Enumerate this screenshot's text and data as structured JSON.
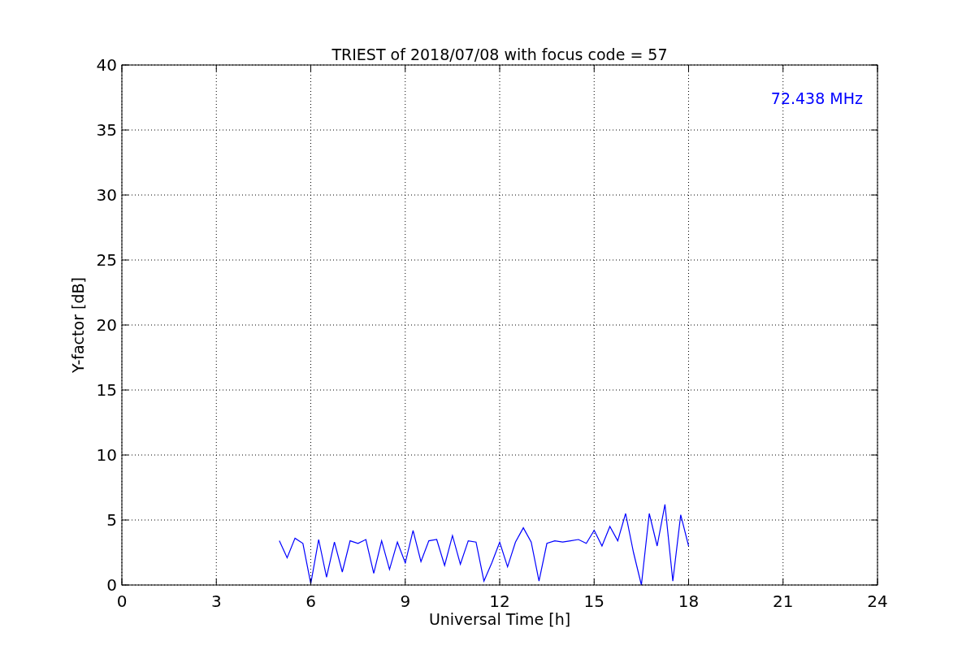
{
  "chart_data": {
    "type": "line",
    "title": "TRIEST of 2018/07/08 with focus code = 57",
    "xlabel": "Universal Time [h]",
    "ylabel": "Y-factor [dB]",
    "grid": true,
    "xlim": [
      0,
      24
    ],
    "ylim": [
      0,
      40
    ],
    "xticks": [
      0,
      3,
      6,
      9,
      12,
      15,
      18,
      21,
      24
    ],
    "yticks": [
      0,
      5,
      10,
      15,
      20,
      25,
      30,
      35,
      40
    ],
    "x": [
      5,
      5.25,
      5.5,
      5.75,
      6,
      6.25,
      6.5,
      6.75,
      7,
      7.25,
      7.5,
      7.75,
      8,
      8.25,
      8.5,
      8.75,
      9,
      9.25,
      9.5,
      9.75,
      10,
      10.25,
      10.5,
      10.75,
      11,
      11.25,
      11.5,
      11.75,
      12,
      12.25,
      12.5,
      12.75,
      13,
      13.25,
      13.5,
      13.75,
      14,
      14.25,
      14.5,
      14.75,
      15,
      15.25,
      15.5,
      15.75,
      16,
      16.25,
      16.5,
      16.75,
      17,
      17.25,
      17.5,
      17.75,
      18
    ],
    "series": [
      {
        "color": "#0000ff",
        "values": [
          3.4,
          2.1,
          3.6,
          3.2,
          0.1,
          3.5,
          0.6,
          3.3,
          1.0,
          3.4,
          3.2,
          3.5,
          0.9,
          3.4,
          1.2,
          3.3,
          1.7,
          4.2,
          1.8,
          3.4,
          3.5,
          1.5,
          3.8,
          1.6,
          3.4,
          3.3,
          0.3,
          1.7,
          3.3,
          1.4,
          3.3,
          4.4,
          3.3,
          0.3,
          3.2,
          3.4,
          3.3,
          3.4,
          3.5,
          3.2,
          4.2,
          3.0,
          4.5,
          3.4,
          5.5,
          2.5,
          0,
          5.5,
          3.0,
          6.2,
          0.3,
          5.4,
          3.0
        ]
      }
    ],
    "annotations": [
      {
        "text": "72.438 MHz"
      }
    ]
  }
}
